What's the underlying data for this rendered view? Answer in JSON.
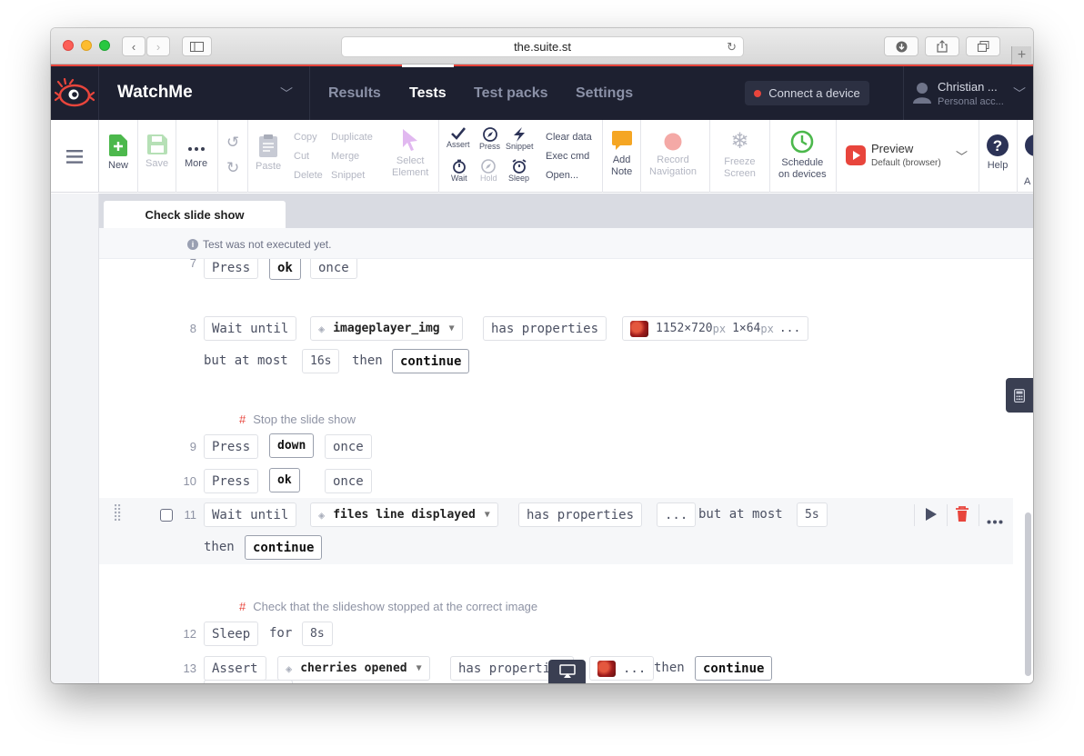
{
  "browser": {
    "url": "the.suite.st"
  },
  "app": {
    "name": "WatchMe",
    "tabs": [
      "Results",
      "Tests",
      "Test packs",
      "Settings"
    ],
    "active_tab": "Tests",
    "connect_label": "Connect a device",
    "user_name": "Christian ...",
    "user_sub": "Personal acc..."
  },
  "toolbar": {
    "new": "New",
    "save": "Save",
    "more": "More",
    "copy": "Copy",
    "cut": "Cut",
    "delete": "Delete",
    "paste": "Paste",
    "duplicate": "Duplicate",
    "merge": "Merge",
    "snippet": "Snippet",
    "select_element": [
      "Select",
      "Element"
    ],
    "assert": "Assert",
    "press": "Press",
    "snippet2": "Snippet",
    "wait": "Wait",
    "hold": "Hold",
    "sleep": "Sleep",
    "clear_data": "Clear data",
    "exec_cmd": "Exec cmd",
    "open": "Open...",
    "add_note": [
      "Add",
      "Note"
    ],
    "record_navigation": [
      "Record",
      "Navigation"
    ],
    "freeze_screen": [
      "Freeze",
      "Screen"
    ],
    "schedule": [
      "Schedule",
      "on devices"
    ],
    "preview_title": "Preview",
    "preview_sub": "Default (browser)",
    "help": "Help",
    "cut_off_label": "A"
  },
  "editor": {
    "tab_title": "Check slide show",
    "notice": "Test was not executed yet.",
    "lines": {
      "l7": {
        "num": "7",
        "action": "Press",
        "key": "ok",
        "mode": "once"
      },
      "l8": {
        "num": "8",
        "action": "Wait until",
        "element": "imageplayer_img",
        "cond": "has properties",
        "dims": "1152×720",
        "unit1": "px",
        "dims2": "1×64",
        "unit2": "px",
        "ellipsis": "...",
        "but": "but at most",
        "timeout": "16s",
        "then": "then",
        "result": "continue"
      },
      "c1": "Stop the slide show",
      "l9": {
        "num": "9",
        "action": "Press",
        "key": "down",
        "mode": "once"
      },
      "l10": {
        "num": "10",
        "action": "Press",
        "key": "ok",
        "mode": "once"
      },
      "l11": {
        "num": "11",
        "action": "Wait until",
        "element": "files line displayed",
        "cond": "has properties",
        "ellipsis": "...",
        "but": "but at most",
        "timeout": "5s",
        "then": "then",
        "result": "continue"
      },
      "c2": "Check that the slideshow stopped at the correct image",
      "l12": {
        "num": "12",
        "action": "Sleep",
        "for": "for",
        "duration": "8s"
      },
      "l13": {
        "num": "13",
        "action": "Assert",
        "element": "cherries opened",
        "cond": "has properties",
        "ellipsis": "...",
        "then": "then",
        "result": "continue"
      }
    }
  },
  "colors": {
    "nav_bg": "#1d2030",
    "accent_red": "#e8453c",
    "new_green": "#4cb84c",
    "note_orange": "#f5a623",
    "schedule_green": "#4cb84c",
    "help_navy": "#2c3357"
  }
}
